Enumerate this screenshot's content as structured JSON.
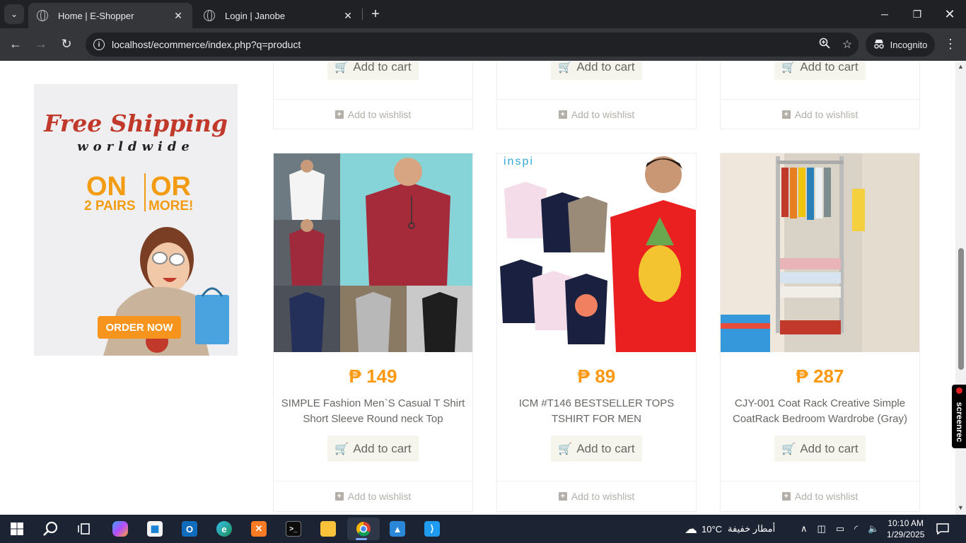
{
  "browser": {
    "tabs": [
      {
        "title": "Home | E-Shopper",
        "active": true
      },
      {
        "title": "Login | Janobe",
        "active": false
      }
    ],
    "url": "localhost/ecommerce/index.php?q=product",
    "incognito_label": "Incognito"
  },
  "promo": {
    "headline": "Free Shipping",
    "subheadline": "worldwide",
    "on": "ON",
    "or": "OR",
    "pairs": "2 PAIRS",
    "more": "MORE!",
    "cta": "ORDER NOW"
  },
  "labels": {
    "add_to_cart": "Add to cart",
    "add_to_wishlist": "Add to wishlist"
  },
  "products": [
    {
      "price": "₱ 149",
      "name": "SIMPLE Fashion Men`S Casual T Shirt Short Sleeve Round neck Top"
    },
    {
      "price": "₱ 89",
      "name": "ICM #T146 BESTSELLER TOPS TSHIRT FOR MEN",
      "brand": "inspi"
    },
    {
      "price": "₱ 287",
      "name": "CJY-001 Coat Rack Creative Simple CoatRack Bedroom Wardrobe (Gray)"
    }
  ],
  "screenrec_label": "screenrec",
  "taskbar": {
    "weather_temp": "10°C",
    "weather_desc": "أمطار خفيفة",
    "time": "10:10 AM",
    "date": "1/29/2025"
  },
  "colors": {
    "accent_orange": "#fe980f",
    "chrome_dark": "#202124",
    "chrome_toolbar": "#35363a",
    "taskbar": "#1c2434"
  }
}
